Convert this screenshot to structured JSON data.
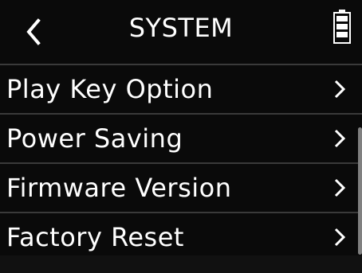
{
  "header": {
    "title": "SYSTEM",
    "back_icon": "chevron-left-icon",
    "battery_icon": "battery-icon"
  },
  "menu": {
    "items": [
      {
        "label": "Play Key Option",
        "icon": "chevron-right-icon"
      },
      {
        "label": "Power Saving",
        "icon": "chevron-right-icon"
      },
      {
        "label": "Firmware Version",
        "icon": "chevron-right-icon"
      },
      {
        "label": "Factory Reset",
        "icon": "chevron-right-icon"
      }
    ]
  },
  "colors": {
    "background": "#0a0a0a",
    "divider": "#3a3a3a",
    "text": "#ffffff",
    "scrollbar": "#808080"
  }
}
